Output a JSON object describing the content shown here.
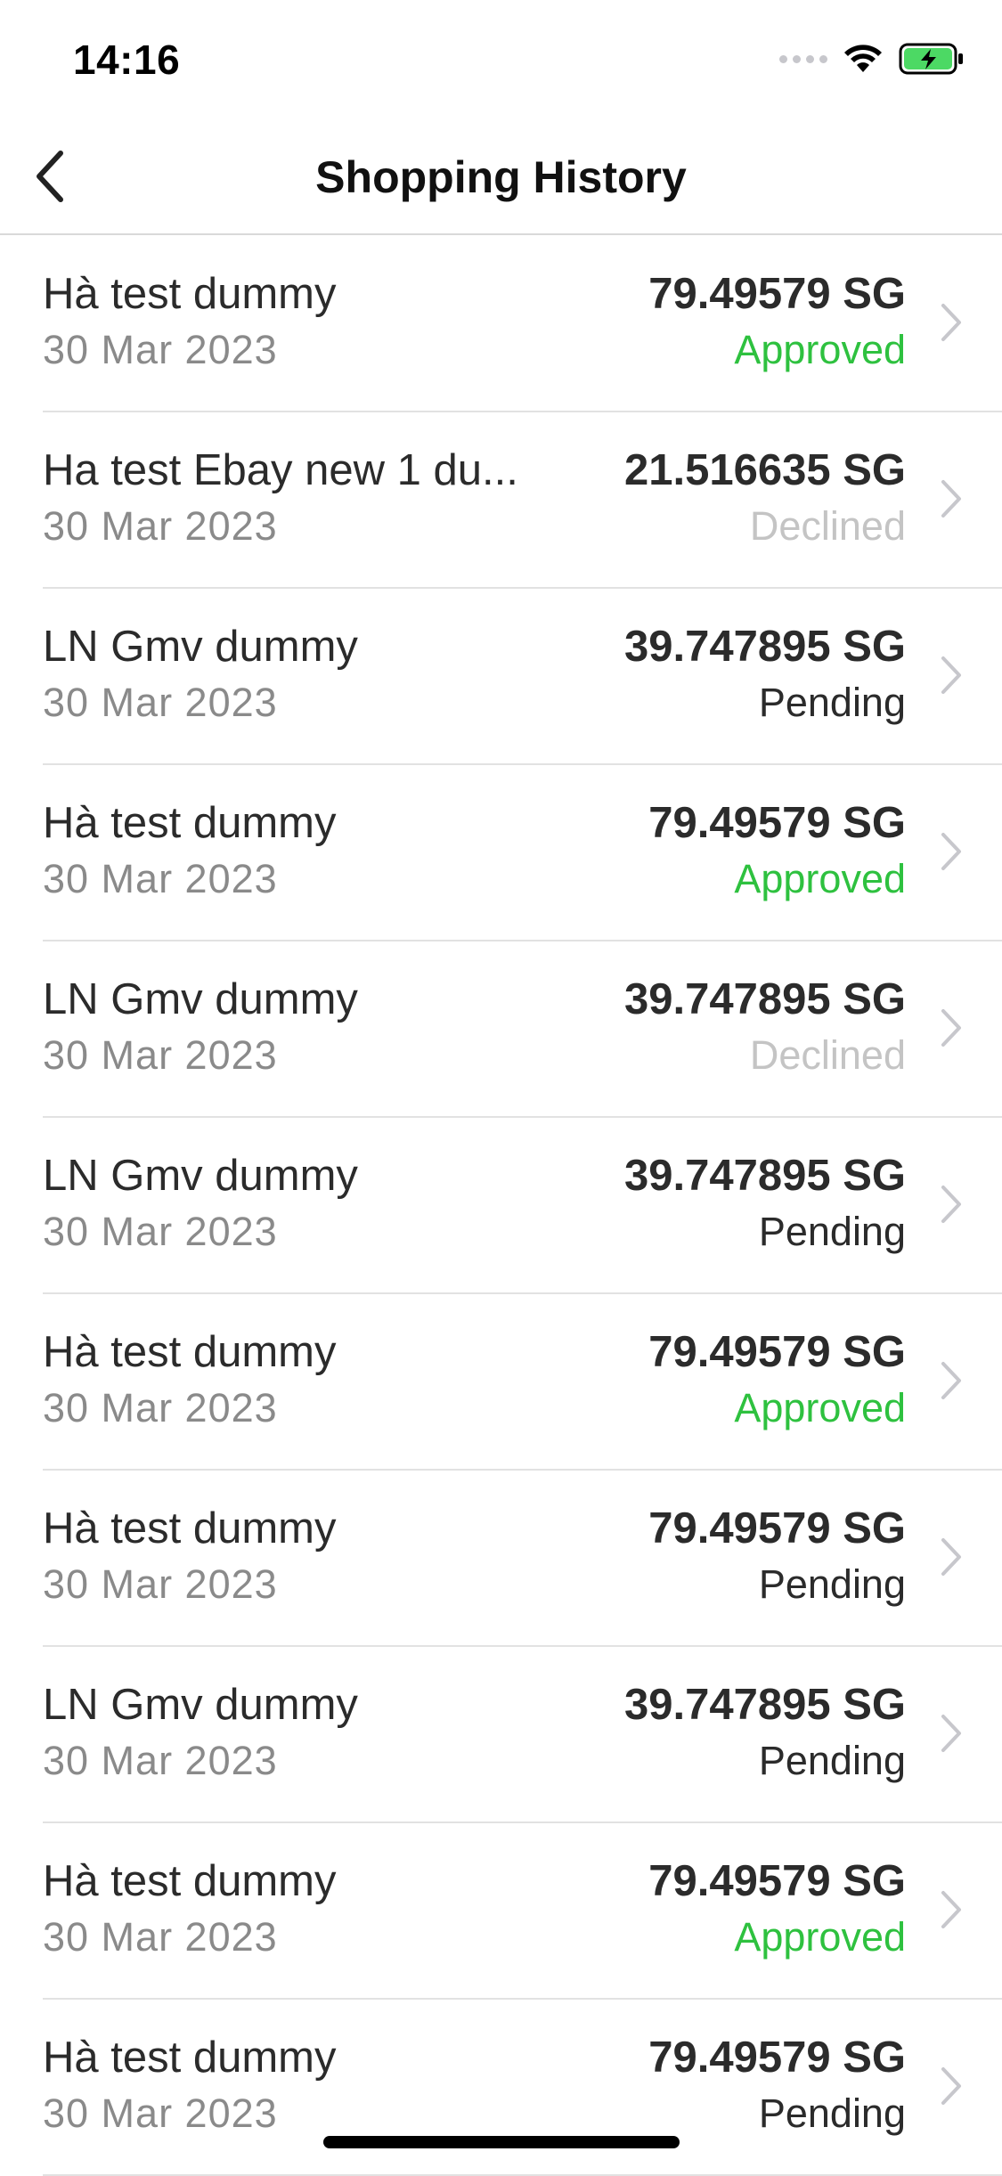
{
  "status_bar": {
    "time": "14:16"
  },
  "header": {
    "title": "Shopping History"
  },
  "colors": {
    "approved": "#2ec13f",
    "declined": "#c4c4c4",
    "pending": "#2b2b2b",
    "battery_fill": "#4cd964"
  },
  "icons": {
    "back": "chevron-left-icon",
    "row": "chevron-right-icon",
    "wifi": "wifi-icon",
    "battery": "battery-charging-icon",
    "signal": "cellular-signal-icon"
  },
  "transactions": [
    {
      "title": "Hà test dummy",
      "date": "30 Mar 2023",
      "amount": "79.49579 SG",
      "status": "Approved",
      "status_type": "approved"
    },
    {
      "title": "Ha test Ebay new 1 du...",
      "date": "30 Mar 2023",
      "amount": "21.516635 SG",
      "status": "Declined",
      "status_type": "declined"
    },
    {
      "title": "LN Gmv dummy",
      "date": "30 Mar 2023",
      "amount": "39.747895 SG",
      "status": "Pending",
      "status_type": "pending"
    },
    {
      "title": "Hà test dummy",
      "date": "30 Mar 2023",
      "amount": "79.49579 SG",
      "status": "Approved",
      "status_type": "approved"
    },
    {
      "title": "LN Gmv dummy",
      "date": "30 Mar 2023",
      "amount": "39.747895 SG",
      "status": "Declined",
      "status_type": "declined"
    },
    {
      "title": "LN Gmv dummy",
      "date": "30 Mar 2023",
      "amount": "39.747895 SG",
      "status": "Pending",
      "status_type": "pending"
    },
    {
      "title": "Hà test dummy",
      "date": "30 Mar 2023",
      "amount": "79.49579 SG",
      "status": "Approved",
      "status_type": "approved"
    },
    {
      "title": "Hà test dummy",
      "date": "30 Mar 2023",
      "amount": "79.49579 SG",
      "status": "Pending",
      "status_type": "pending"
    },
    {
      "title": "LN Gmv dummy",
      "date": "30 Mar 2023",
      "amount": "39.747895 SG",
      "status": "Pending",
      "status_type": "pending"
    },
    {
      "title": "Hà test dummy",
      "date": "30 Mar 2023",
      "amount": "79.49579 SG",
      "status": "Approved",
      "status_type": "approved"
    },
    {
      "title": "Hà test dummy",
      "date": "30 Mar 2023",
      "amount": "79.49579 SG",
      "status": "Pending",
      "status_type": "pending"
    }
  ]
}
